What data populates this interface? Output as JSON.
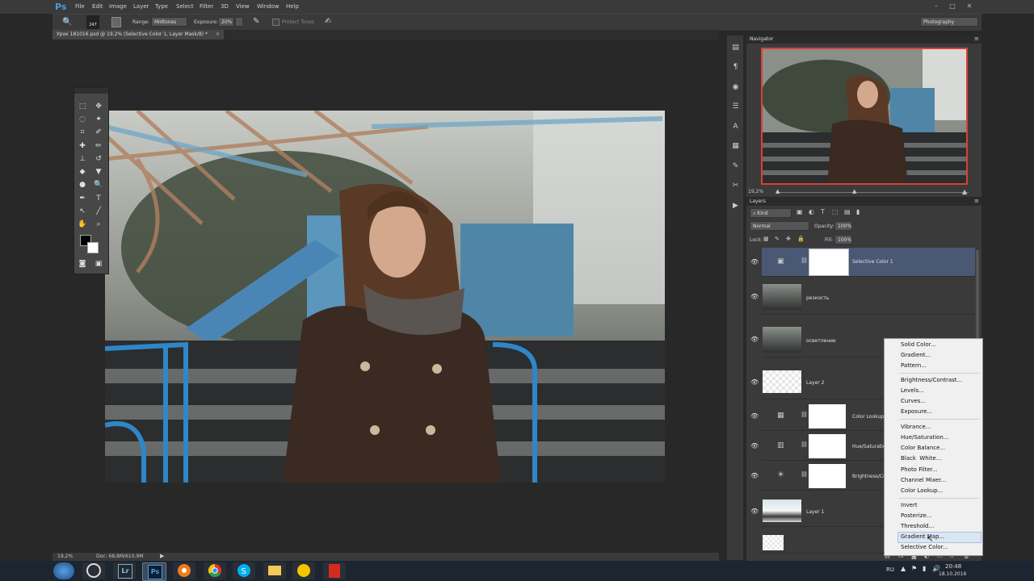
{
  "app": {
    "logo": "Ps"
  },
  "menu": [
    "File",
    "Edit",
    "Image",
    "Layer",
    "Type",
    "Select",
    "Filter",
    "3D",
    "View",
    "Window",
    "Help"
  ],
  "window_controls": {
    "minimize": "–",
    "maximize": "□",
    "close": "✕"
  },
  "options_bar": {
    "brush_size": "247",
    "range_label": "Range:",
    "range_value": "Midtones",
    "exposure_label": "Exposure:",
    "exposure_value": "20%",
    "protect_tones": "Protect Tones",
    "workspace": "Photography"
  },
  "document": {
    "tab_title": "Урок 181016.psd @ 19,2% (Selective Color 1, Layer Mask/8) *",
    "zoom": "19,2%",
    "doc_info": "Doc: 68,8M/610,9M"
  },
  "navigator": {
    "title": "Navigator",
    "zoom": "19,2%"
  },
  "layers_panel": {
    "title": "Layers",
    "kind": "Kind",
    "blend_mode": "Normal",
    "opacity_label": "Opacity:",
    "opacity_value": "100%",
    "lock_label": "Lock:",
    "fill_label": "Fill:",
    "fill_value": "100%",
    "layers": [
      {
        "name": "Selective Color 1",
        "type": "adjustment",
        "selected": true
      },
      {
        "name": "резкость",
        "type": "photo"
      },
      {
        "name": "осветление",
        "type": "photo"
      },
      {
        "name": "Layer 2",
        "type": "transparent"
      },
      {
        "name": "Color Lookup 1",
        "type": "adjustment"
      },
      {
        "name": "Hue/Saturation 1",
        "type": "adjustment"
      },
      {
        "name": "Brightness/Contrast 1",
        "type": "adjustment"
      },
      {
        "name": "Layer 1",
        "type": "photo-light"
      },
      {
        "name": "",
        "type": "transparent"
      }
    ]
  },
  "adjustment_menu": {
    "groups": [
      [
        "Solid Color...",
        "Gradient...",
        "Pattern..."
      ],
      [
        "Brightness/Contrast...",
        "Levels...",
        "Curves...",
        "Exposure..."
      ],
      [
        "Vibrance...",
        "Hue/Saturation...",
        "Color Balance...",
        "Black  White...",
        "Photo Filter...",
        "Channel Mixer...",
        "Color Lookup..."
      ],
      [
        "Invert",
        "Posterize...",
        "Threshold...",
        "Gradient Map...",
        "Selective Color..."
      ]
    ],
    "highlighted": "Gradient Map..."
  },
  "taskbar": {
    "lang": "RU",
    "time": "20:48",
    "date": "18.10.2016",
    "apps": [
      "windows-start",
      "chrome-dark",
      "lightroom",
      "photoshop",
      "avast",
      "chrome",
      "skype",
      "file-explorer",
      "norton",
      "acrobat"
    ]
  },
  "colors": {
    "accent_blue": "#4d9de0",
    "selected_layer": "#4a5873",
    "nav_box": "#d8403a"
  }
}
